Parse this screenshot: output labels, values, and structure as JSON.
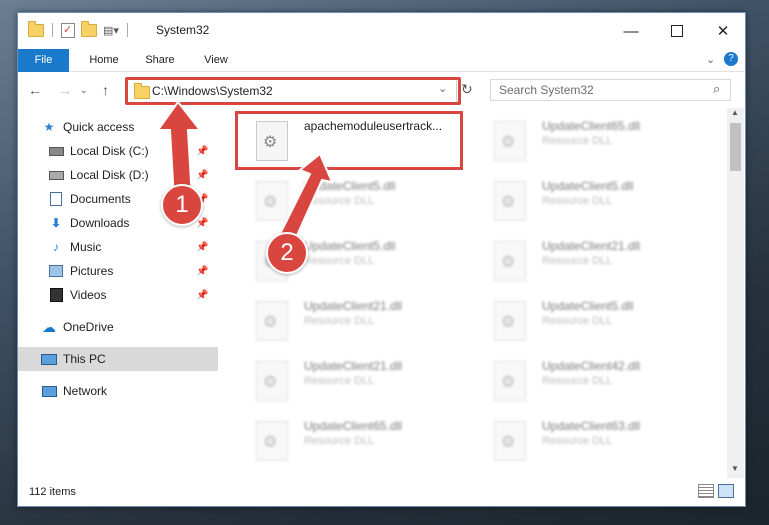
{
  "window": {
    "title": "System32"
  },
  "ribbon": {
    "tabs": [
      "File",
      "Home",
      "Share",
      "View"
    ]
  },
  "address": {
    "path": "C:\\Windows\\System32",
    "refresh_icon": "refresh-icon"
  },
  "search": {
    "placeholder": "Search System32"
  },
  "nav": {
    "items": [
      {
        "label": "Quick access",
        "icon": "star-icon"
      },
      {
        "label": "Local Disk (C:)",
        "icon": "drive-icon"
      },
      {
        "label": "Local Disk (D:)",
        "icon": "drive-icon"
      },
      {
        "label": "Documents",
        "icon": "documents-icon"
      },
      {
        "label": "Downloads",
        "icon": "downloads-icon"
      },
      {
        "label": "Music",
        "icon": "music-icon"
      },
      {
        "label": "Pictures",
        "icon": "pictures-icon"
      },
      {
        "label": "Videos",
        "icon": "videos-icon"
      },
      {
        "label": "OneDrive",
        "icon": "cloud-icon"
      },
      {
        "label": "This PC",
        "icon": "pc-icon"
      },
      {
        "label": "Network",
        "icon": "network-icon"
      }
    ]
  },
  "files": {
    "col1": [
      {
        "name": "apachemoduleusertrack...",
        "type": ""
      },
      {
        "name": "UpdateClient5.dll",
        "type": "Resource DLL"
      },
      {
        "name": "UpdateClient5.dll",
        "type": "Resource DLL"
      },
      {
        "name": "UpdateClient21.dll",
        "type": "Resource DLL"
      },
      {
        "name": "UpdateClient21.dll",
        "type": "Resource DLL"
      },
      {
        "name": "UpdateClient65.dll",
        "type": "Resource DLL"
      }
    ],
    "col2": [
      {
        "name": "UpdateClient65.dll",
        "type": "Resource DLL"
      },
      {
        "name": "UpdateClient5.dll",
        "type": "Resource DLL"
      },
      {
        "name": "UpdateClient21.dll",
        "type": "Resource DLL"
      },
      {
        "name": "UpdateClient5.dll",
        "type": "Resource DLL"
      },
      {
        "name": "UpdateClient42.dll",
        "type": "Resource DLL"
      },
      {
        "name": "UpdateClient63.dll",
        "type": "Resource DLL"
      }
    ]
  },
  "status": {
    "count": "112 items"
  },
  "annotations": {
    "step1": "1",
    "step2": "2"
  },
  "colors": {
    "accent": "#1979ca",
    "highlight": "#d9453f"
  }
}
